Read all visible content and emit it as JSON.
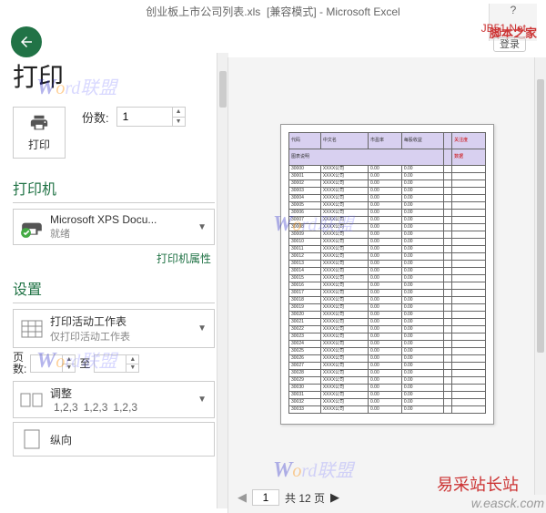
{
  "titlebar": {
    "filename": "创业板上市公司列表.xls",
    "mode": "[兼容模式]",
    "app": "Microsoft Excel",
    "login": "登录"
  },
  "watermarks": {
    "word": "Word联盟",
    "jb": "JB51.Net",
    "script": "脚本之家",
    "easck": "易采站长站",
    "easck_en": "w.easck.com"
  },
  "print": {
    "title": "打印",
    "button_label": "打印",
    "copies_label": "份数:",
    "copies_value": "1"
  },
  "printer": {
    "heading": "打印机",
    "name": "Microsoft XPS Docu...",
    "status": "就绪",
    "properties_link": "打印机属性"
  },
  "settings": {
    "heading": "设置",
    "scope": {
      "l1": "打印活动工作表",
      "l2": "仅打印活动工作表"
    },
    "pages_label": "页\n数:",
    "pages_to": "至",
    "collate": {
      "l1": "调整",
      "seq": "1,2,3"
    },
    "orientation": "纵向"
  },
  "nav": {
    "current": "1",
    "total": "共 12 页"
  },
  "preview": {
    "header_cells": [
      "代码",
      "中文名",
      "市盈率",
      "每股收益",
      "",
      "关注度"
    ],
    "rows_count": 34
  }
}
